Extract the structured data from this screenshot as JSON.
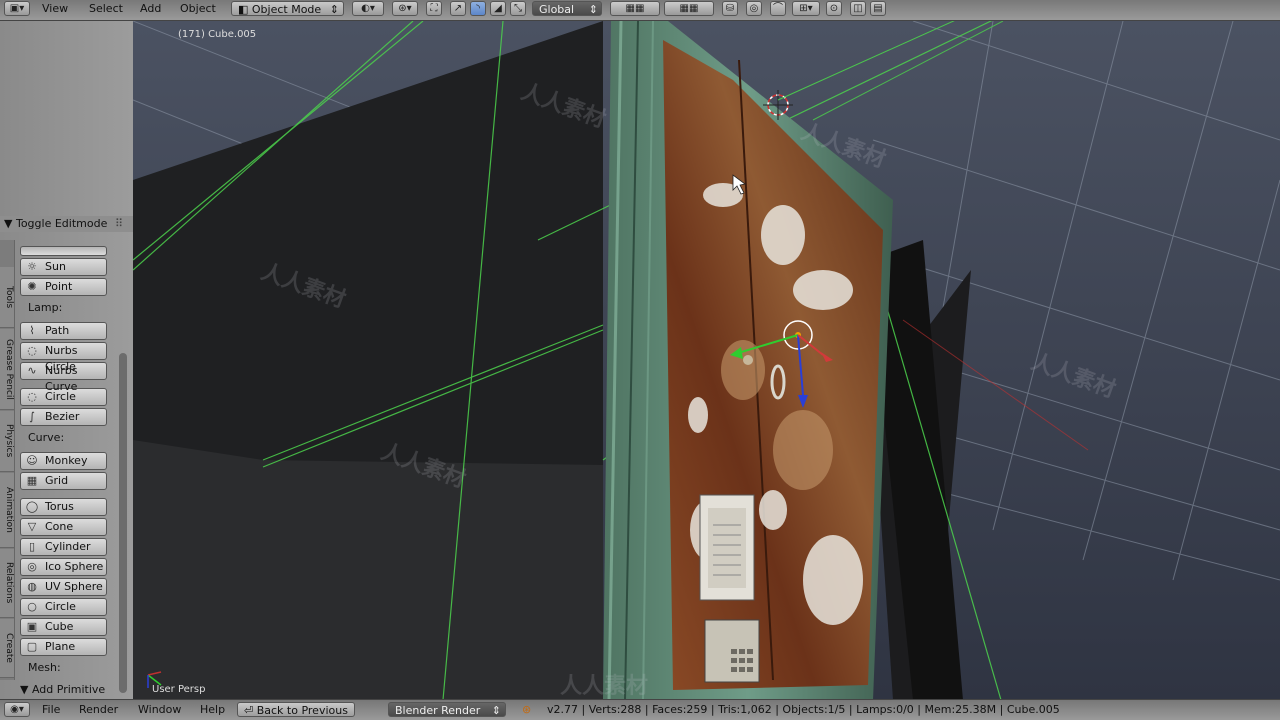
{
  "top_menu": {
    "file": "File",
    "render": "Render",
    "window": "Window",
    "help": "Help",
    "back": "Back to Previous",
    "engine": "Blender Render",
    "stats": "v2.77 | Verts:288 | Faces:259 | Tris:1,062 | Objects:1/5 | Lamps:0/0 | Mem:25.38M | Cube.005"
  },
  "view_header": {
    "view": "View",
    "select": "Select",
    "add": "Add",
    "object": "Object",
    "mode": "Object Mode",
    "orientation": "Global"
  },
  "viewport": {
    "object_info": "(171) Cube.005",
    "view_name": "User Persp",
    "watermark": "人人素材"
  },
  "toolshelf": {
    "tabs": [
      "Create",
      "Relations",
      "Animation",
      "Physics",
      "Grease Pencil",
      "Tools"
    ],
    "panel_title": "Add Primitive",
    "toggle_editmode": "Toggle Editmode",
    "mesh_label": "Mesh:",
    "mesh": [
      "Plane",
      "Cube",
      "Circle",
      "UV Sphere",
      "Ico Sphere",
      "Cylinder",
      "Cone",
      "Torus",
      "Grid",
      "Monkey"
    ],
    "curve_label": "Curve:",
    "curve": [
      "Bezier",
      "Circle",
      "Nurbs Curve",
      "Nurbs Circle",
      "Path"
    ],
    "lamp_label": "Lamp:",
    "lamp": [
      "Point",
      "Sun",
      "Spot"
    ]
  },
  "colors": {
    "viewport_bg": "#3a3f4c",
    "grid_line": "#8e98a8",
    "selected_edge": "#4cd24c",
    "door_rust": "#7a3a1c",
    "door_green": "#5f8878"
  }
}
